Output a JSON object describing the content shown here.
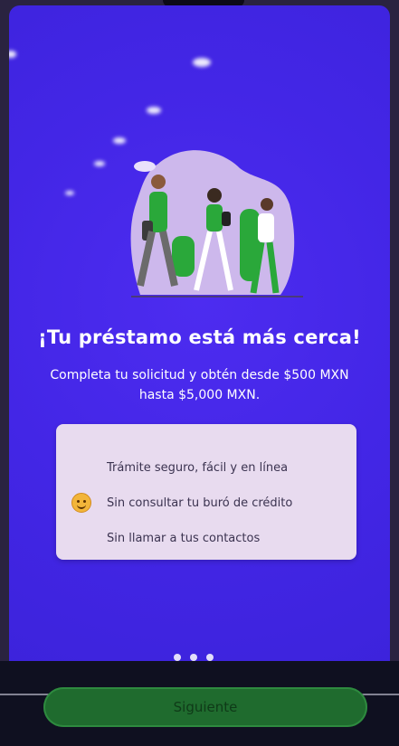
{
  "onboarding": {
    "title": "¡Tu préstamo está más cerca!",
    "subtitle": "Completa tu solicitud y obtén desde $500 MXN hasta $5,000 MXN.",
    "features": [
      {
        "label": "Trámite seguro, fácil y en línea"
      },
      {
        "label": "Sin consultar tu buró de crédito",
        "icon": "smiley-icon"
      },
      {
        "label": "Sin llamar a tus contactos"
      }
    ],
    "pager": {
      "pages": 3
    },
    "next_label": "Siguiente"
  },
  "colors": {
    "background": "#4326e6",
    "card": "#e8dbef",
    "button": "#1f6b2e",
    "accent_green": "#2aa83a"
  }
}
